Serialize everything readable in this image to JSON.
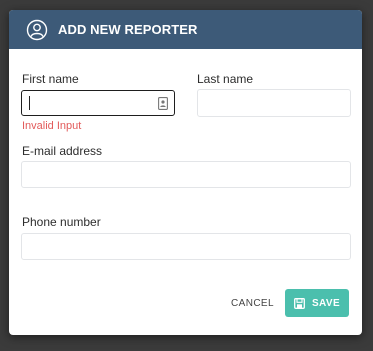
{
  "dialog": {
    "title": "ADD NEW REPORTER",
    "title_icon": "user-circle-icon"
  },
  "form": {
    "first_name": {
      "label": "First name",
      "value": "",
      "error": "Invalid Input",
      "icon": "contact-card-icon"
    },
    "last_name": {
      "label": "Last name",
      "value": ""
    },
    "email": {
      "label": "E-mail address",
      "value": ""
    },
    "phone": {
      "label": "Phone number",
      "value": ""
    }
  },
  "actions": {
    "cancel_label": "CANCEL",
    "save_label": "SAVE",
    "save_icon": "save-icon"
  },
  "colors": {
    "header_bg": "#3d5a78",
    "accent": "#4bbfad",
    "error": "#e25b5b",
    "backdrop": "#3b3b3b"
  }
}
